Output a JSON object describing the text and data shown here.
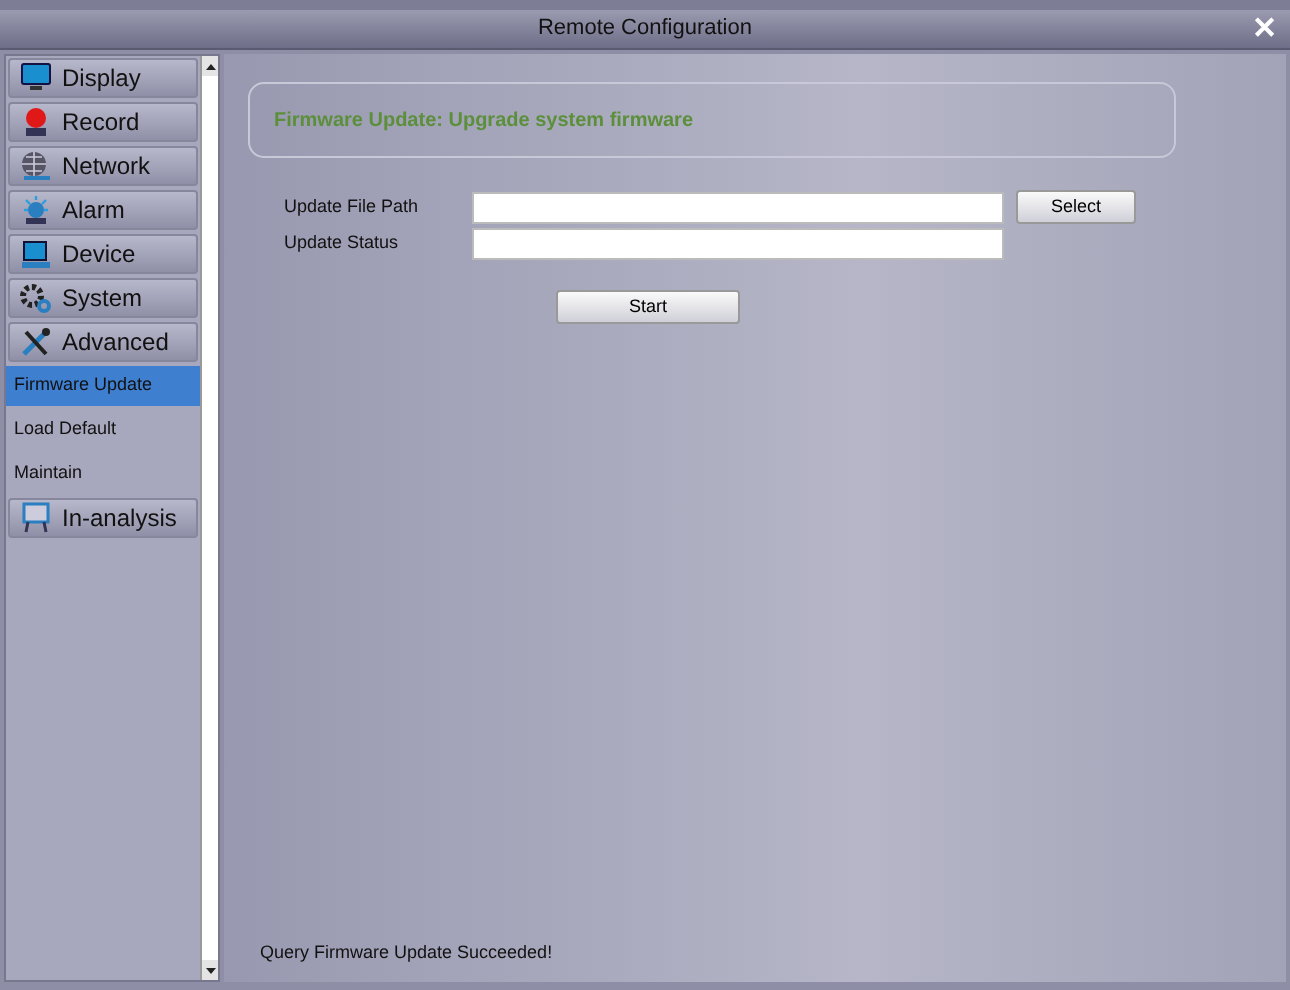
{
  "window": {
    "title": "Remote Configuration",
    "close": "✕"
  },
  "sidebar": {
    "items": [
      {
        "kind": "category",
        "label": "Display"
      },
      {
        "kind": "category",
        "label": "Record"
      },
      {
        "kind": "category",
        "label": "Network"
      },
      {
        "kind": "category",
        "label": "Alarm"
      },
      {
        "kind": "category",
        "label": "Device"
      },
      {
        "kind": "category",
        "label": "System"
      },
      {
        "kind": "category",
        "label": "Advanced"
      },
      {
        "kind": "sub",
        "label": "Firmware Update",
        "selected": true
      },
      {
        "kind": "sub",
        "label": "Load Default",
        "selected": false
      },
      {
        "kind": "sub",
        "label": "Maintain",
        "selected": false
      },
      {
        "kind": "category",
        "label": "In-analysis"
      }
    ]
  },
  "header": {
    "text": "Firmware Update: Upgrade system firmware"
  },
  "form": {
    "fields": [
      {
        "label": "Update File Path",
        "button": "Select"
      },
      {
        "label": "Update Status"
      }
    ],
    "start_button": "Start"
  },
  "status_bar": "Query Firmware Update Succeeded!"
}
